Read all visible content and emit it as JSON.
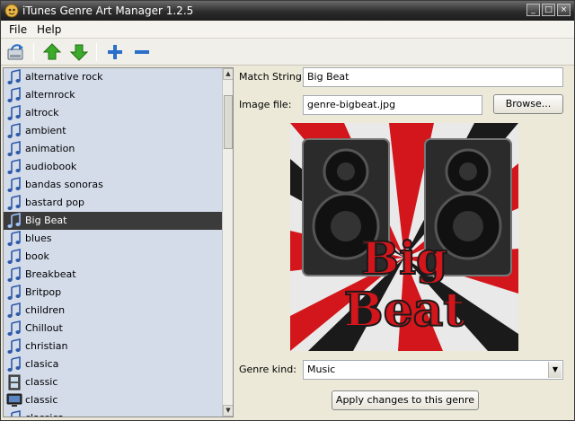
{
  "window": {
    "title": "iTunes Genre Art Manager 1.2.5",
    "controls": [
      "_",
      "□",
      "×"
    ]
  },
  "menu": {
    "file": "File",
    "help": "Help"
  },
  "toolbar": {
    "icons": [
      "refresh-icon",
      "move-up-icon",
      "move-down-icon",
      "add-icon",
      "remove-icon"
    ],
    "colors": {
      "arrow": "#3caa2a",
      "plusminus": "#2a6fc9"
    }
  },
  "genres": [
    {
      "label": "alternative rock",
      "icon": "music-note-icon"
    },
    {
      "label": "alternrock",
      "icon": "music-note-icon"
    },
    {
      "label": "altrock",
      "icon": "music-note-icon"
    },
    {
      "label": "ambient",
      "icon": "music-note-icon"
    },
    {
      "label": "animation",
      "icon": "music-note-icon"
    },
    {
      "label": "audiobook",
      "icon": "music-note-icon"
    },
    {
      "label": "bandas sonoras",
      "icon": "music-note-icon"
    },
    {
      "label": "bastard pop",
      "icon": "music-note-icon"
    },
    {
      "label": "Big Beat",
      "icon": "music-note-icon",
      "selected": true
    },
    {
      "label": "blues",
      "icon": "music-note-icon"
    },
    {
      "label": "book",
      "icon": "music-note-icon"
    },
    {
      "label": "Breakbeat",
      "icon": "music-note-icon"
    },
    {
      "label": "Britpop",
      "icon": "music-note-icon"
    },
    {
      "label": "children",
      "icon": "music-note-icon"
    },
    {
      "label": "Chillout",
      "icon": "music-note-icon"
    },
    {
      "label": "christian",
      "icon": "music-note-icon"
    },
    {
      "label": "clasica",
      "icon": "music-note-icon"
    },
    {
      "label": "classic",
      "icon": "film-icon"
    },
    {
      "label": "classic",
      "icon": "tv-icon"
    },
    {
      "label": "classica",
      "icon": "music-note-icon"
    }
  ],
  "detail": {
    "match_label": "Match String:",
    "match_value": "Big Beat",
    "image_label": "Image file:",
    "image_value": "genre-bigbeat.jpg",
    "browse_label": "Browse...",
    "art_line1": "Big",
    "art_line2": "Beat",
    "kind_label": "Genre kind:",
    "kind_value": "Music",
    "apply_label": "Apply changes to this genre"
  },
  "colors": {
    "selection_bg": "#3b3b3b",
    "list_bg": "#d4dcea",
    "art_red": "#d2161b",
    "art_dark": "#1a1a1a"
  }
}
